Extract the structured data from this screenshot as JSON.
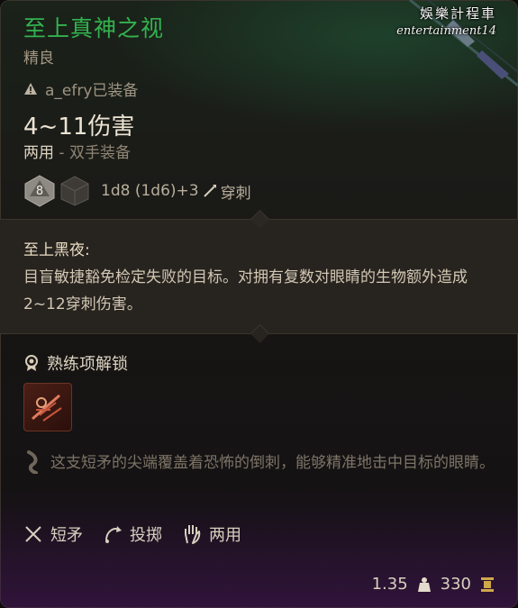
{
  "item": {
    "name": "至上真神之视",
    "rarity": "精良",
    "equipped_by": "a_efry已装备",
    "damage": "4~11伤害",
    "handedness": "两用",
    "handedness_sep": " - ",
    "equip_slot": "双手装备",
    "die_value": "8",
    "damage_formula": "1d8 (1d6)+3",
    "damage_type": "穿刺"
  },
  "passive": {
    "name": "至上黑夜:",
    "description": "目盲敏捷豁免检定失败的目标。对拥有复数对眼睛的生物额外造成2~12穿刺伤害。"
  },
  "proficiency": {
    "label": "熟练项解锁"
  },
  "lore": "这支短矛的尖端覆盖着恐怖的倒刺，能够精准地击中目标的眼睛。",
  "properties": [
    {
      "icon": "crossed-spears-icon",
      "label": "短矛"
    },
    {
      "icon": "thrown-icon",
      "label": "投掷"
    },
    {
      "icon": "hand-icon",
      "label": "两用"
    }
  ],
  "footer": {
    "weight": "1.35",
    "value": "330"
  },
  "watermark": {
    "line1": "娛樂計程車",
    "line2": "entertainment14"
  },
  "colors": {
    "title": "#33b24f",
    "passive_bg": "#27231f",
    "lore_text": "#7d7466"
  }
}
